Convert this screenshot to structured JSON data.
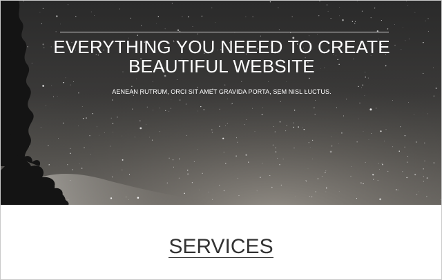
{
  "hero": {
    "title_line1": "EVERYTHING YOU NEEED TO CREATE",
    "title_line2": "BEAUTIFUL WEBSITE",
    "subtitle": "AENEAN RUTRUM, ORCI SIT AMET GRAVIDA PORTA, SEM NISL LUCTUS."
  },
  "services": {
    "heading": "SERVICES"
  }
}
